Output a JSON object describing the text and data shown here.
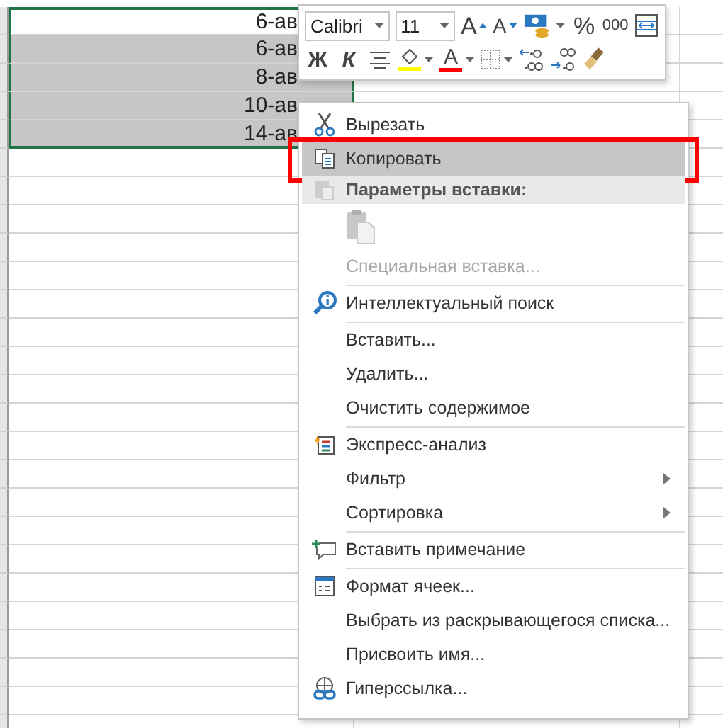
{
  "sheet": {
    "rows": [
      {
        "column_1": "6-ав",
        "selected": true,
        "active": true
      },
      {
        "column_1": "6-ав",
        "selected": true,
        "active": false
      },
      {
        "column_1": "8-ав",
        "selected": true,
        "active": false
      },
      {
        "column_1": "10-ав",
        "selected": true,
        "active": false
      },
      {
        "column_1": "14-ав",
        "selected": true,
        "active": false
      }
    ]
  },
  "mini_toolbar": {
    "format_row": [
      {
        "kind": "dropdown",
        "value": "Calibri"
      },
      {
        "kind": "dropdown",
        "value": "11"
      },
      {
        "kind": "grow",
        "label": "A"
      },
      {
        "kind": "shrink",
        "label": "A"
      },
      {
        "kind": "accounting"
      },
      {
        "kind": "text",
        "label": "%"
      },
      {
        "kind": "small",
        "label": "000"
      },
      {
        "kind": "wrap"
      }
    ],
    "style_row": [
      {
        "kind": "bold",
        "label": "Ж"
      },
      {
        "kind": "italic",
        "label": "К"
      },
      {
        "kind": "align"
      },
      {
        "kind": "fill",
        "color": "#ffff00"
      },
      {
        "kind": "fontcolor",
        "label": "A",
        "color": "#ff0000"
      },
      {
        "kind": "borders"
      },
      {
        "kind": "incdec"
      },
      {
        "kind": "decdec"
      },
      {
        "kind": "painter"
      }
    ]
  },
  "context_menu": {
    "items": [
      {
        "kind": "item",
        "label": "Вырезать",
        "selected": false,
        "disabled": false
      },
      {
        "kind": "item",
        "label": "Копировать",
        "selected": true,
        "disabled": false
      },
      {
        "kind": "header",
        "label": "Параметры вставки:"
      },
      {
        "kind": "paste"
      },
      {
        "kind": "item",
        "label": "Специальная вставка...",
        "selected": false,
        "disabled": true
      },
      {
        "kind": "separator"
      },
      {
        "kind": "item",
        "label": "Интеллектуальный поиск",
        "selected": false,
        "disabled": false
      },
      {
        "kind": "separator"
      },
      {
        "kind": "item",
        "label": "Вставить...",
        "selected": false,
        "disabled": false
      },
      {
        "kind": "item",
        "label": "Удалить...",
        "selected": false,
        "disabled": false
      },
      {
        "kind": "item",
        "label": "Очистить содержимое",
        "selected": false,
        "disabled": false
      },
      {
        "kind": "separator"
      },
      {
        "kind": "item",
        "label": "Экспресс-анализ",
        "selected": false,
        "disabled": false
      },
      {
        "kind": "item",
        "label": "Фильтр",
        "selected": false,
        "disabled": false,
        "submenu": true
      },
      {
        "kind": "item",
        "label": "Сортировка",
        "selected": false,
        "disabled": false,
        "submenu": true
      },
      {
        "kind": "separator"
      },
      {
        "kind": "item",
        "label": "Вставить примечание",
        "selected": false,
        "disabled": false
      },
      {
        "kind": "separator"
      },
      {
        "kind": "item",
        "label": "Формат ячеек...",
        "selected": false,
        "disabled": false
      },
      {
        "kind": "item",
        "label": "Выбрать из раскрывающегося списка...",
        "selected": false,
        "disabled": false
      },
      {
        "kind": "item",
        "label": "Присвоить имя...",
        "selected": false,
        "disabled": false
      },
      {
        "kind": "item",
        "label": "Гиперссылка...",
        "selected": false,
        "disabled": false
      }
    ]
  }
}
